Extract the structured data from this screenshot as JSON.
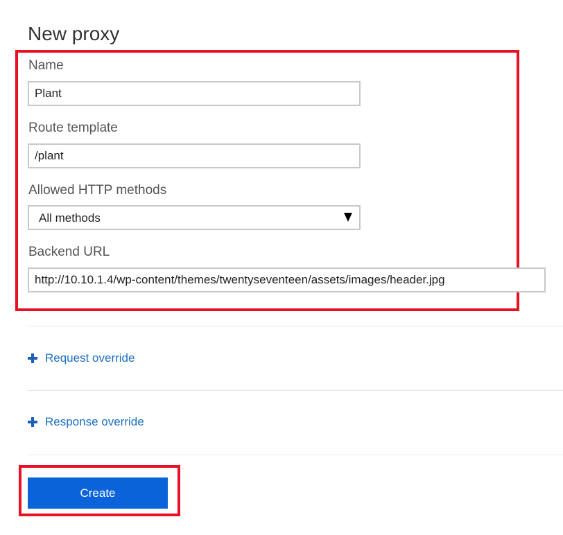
{
  "page": {
    "title": "New proxy"
  },
  "form": {
    "name": {
      "label": "Name",
      "value": "Plant"
    },
    "route_template": {
      "label": "Route template",
      "value": "/plant"
    },
    "allowed_methods": {
      "label": "Allowed HTTP methods",
      "selected": "All methods"
    },
    "backend_url": {
      "label": "Backend URL",
      "value": "http://10.10.1.4/wp-content/themes/twentyseventeen/assets/images/header.jpg"
    }
  },
  "overrides": {
    "request": {
      "label": "Request override",
      "icon": "plus-icon"
    },
    "response": {
      "label": "Response override",
      "icon": "plus-icon"
    }
  },
  "actions": {
    "create_label": "Create"
  },
  "colors": {
    "highlight": "#e81123",
    "link": "#1b6ec2",
    "primary_button": "#0b63d9",
    "field_border": "#c8c8c8"
  }
}
